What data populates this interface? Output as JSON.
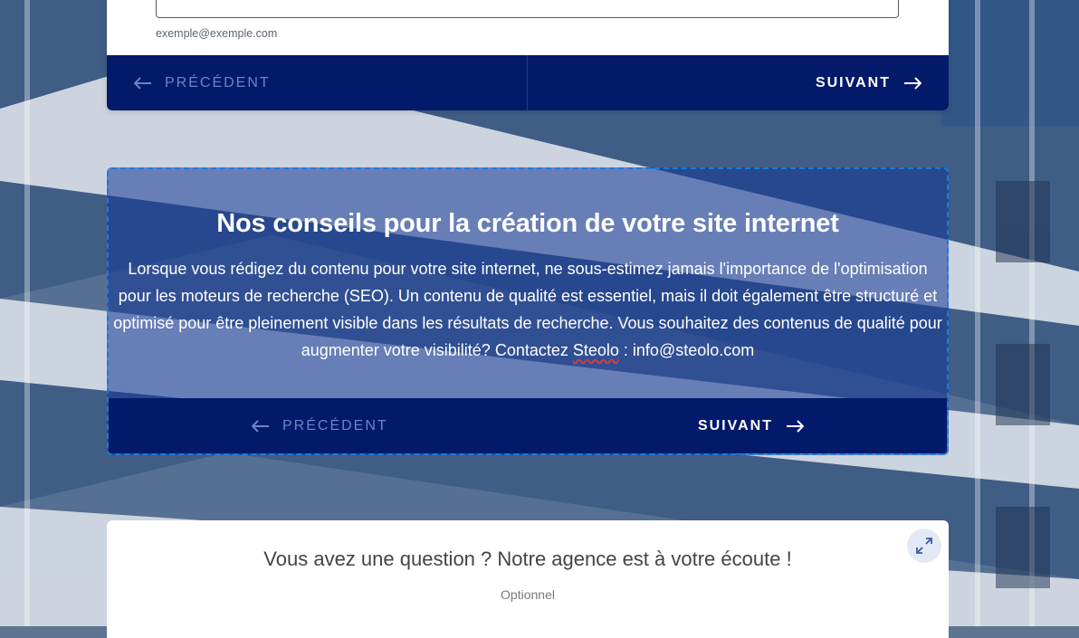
{
  "form_top": {
    "email_hint": "exemple@exemple.com",
    "prev_label": "PRÉCÉDENT",
    "next_label": "SUIVANT"
  },
  "tips": {
    "title": "Nos conseils pour la création de votre site internet",
    "body_part1": "Lorsque vous rédigez du contenu pour votre site internet, ne sous-estimez jamais l'importance de l'optimisation pour les moteurs de recherche (SEO). Un contenu de qualité est essentiel, mais il doit également être structuré et optimisé pour être pleinement visible dans les résultats de recherche. Vous souhaitez des contenus de qualité pour augmenter votre visibilité? Contactez ",
    "body_brand": "Steolo",
    "body_part2": " : info@steolo.com",
    "prev_label": "PRÉCÉDENT",
    "next_label": "SUIVANT"
  },
  "question": {
    "title": "Vous avez une question ? Notre agence est à votre écoute !",
    "optional": "Optionnel"
  },
  "icons": {
    "prev": "arrow-left-icon",
    "next": "arrow-right-icon",
    "expand": "expand-icon"
  },
  "colors": {
    "nav_bg": "#031a6b",
    "accent_dashed": "#1b7be0",
    "prev_text": "#6d84c6"
  }
}
